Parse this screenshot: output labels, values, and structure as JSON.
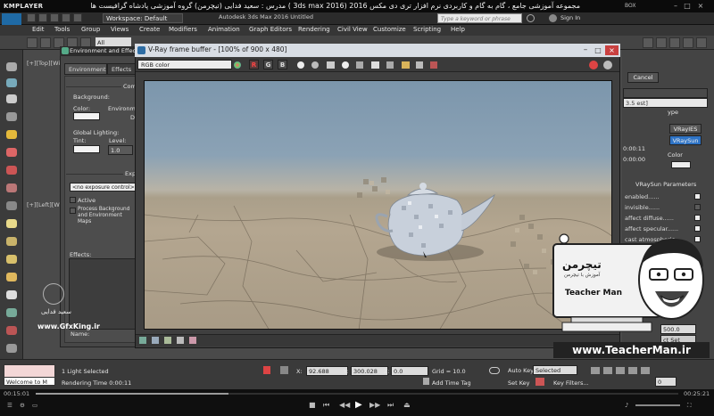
{
  "player": {
    "logo": "KMPLAYER",
    "title": "مجموعه آموزشی جامع ، گام به گام و کاربردی نرم افزار تری دی مکس 2016 (3ds max 2016 ) مدرس : سعید فدایی (تیچرمن) گروه آموزشی پادشاه گرافیست ها",
    "box_label": "BOX",
    "time_elapsed": "00:15:01",
    "time_total": "00:25:21",
    "progress": 0.3
  },
  "max": {
    "logo": "MAX",
    "workspace": "Workspace: Default",
    "doc_title": "Autodesk 3ds Max 2016    Untitled",
    "search_placeholder": "Type a keyword or phrase",
    "signin": "Sign In",
    "menu": [
      "Edit",
      "Tools",
      "Group",
      "Views",
      "Create",
      "Modifiers",
      "Animation",
      "Graph Editors",
      "Rendering",
      "Civil View",
      "Customize",
      "Scripting",
      "Help"
    ],
    "selection_filter": "All",
    "viewport_label_top": "[+][Top][Wir",
    "viewport_label_left": "[+][Left][Wi"
  },
  "env_dialog": {
    "title": "Environment and Effects",
    "tabs": [
      "Environment",
      "Effects"
    ],
    "section_common": "Comm",
    "background_label": "Background:",
    "color_label": "Color:",
    "environment_label": "Environme",
    "d_label": "D",
    "global_lighting": "Global Lighting:",
    "tint_label": "Tint:",
    "level_label": "Level:",
    "level_value": "1.0",
    "exposure_section": "Expo",
    "exposure_control": "<no exposure control>",
    "active_label": "Active",
    "process_label": "Process Background and Environment Maps",
    "effects_label": "Effects:",
    "name_label": "Name:"
  },
  "vfb": {
    "title": "V-Ray frame buffer - [100% of 900 x 480]",
    "channel": "RGB color",
    "rgb_buttons": [
      "R",
      "G",
      "B"
    ]
  },
  "right_panel": {
    "cancel": "Cancel",
    "value_field": "3.5 est]",
    "ype_label": "ype",
    "vrayies": "VRayIES",
    "vraysun_btn": "VRaySun",
    "time1": "0:00:11",
    "time2": "0:00:00",
    "color_label": "Color",
    "rollout_title": "VRaySun Parameters",
    "params": [
      "enabled......",
      "invisible......",
      "affect diffuse......",
      "affect specular......",
      "cast atmospheric......"
    ],
    "value_500": "500.0",
    "select_set": "ct Set"
  },
  "status": {
    "maxscript_welcome": "Welcome to M",
    "selection": "1 Light Selected",
    "rendering_time": "Rendering Time  0:00:11",
    "x_label": "X:",
    "x_value": "92.688",
    "y_label": "Y:",
    "y_value": "300.028",
    "z_label": "Z:",
    "z_value": "0.0",
    "grid": "Grid = 10.0",
    "add_time_tag": "Add Time Tag",
    "auto_key": "Auto Key",
    "selected": "Selected",
    "set_key": "Set Key",
    "key_filters": "Key Filters...",
    "frame": "0"
  },
  "watermark": {
    "gfxking_fa": "سعید فدایی",
    "gfxking": "www.GfxKing.ir",
    "teacherman_fa": "تیچرمن",
    "teacherman_subtitle": "آموزش با تیچرمن",
    "teacherman": "Teacher Man",
    "url": "www.TeacherMan.ir"
  }
}
